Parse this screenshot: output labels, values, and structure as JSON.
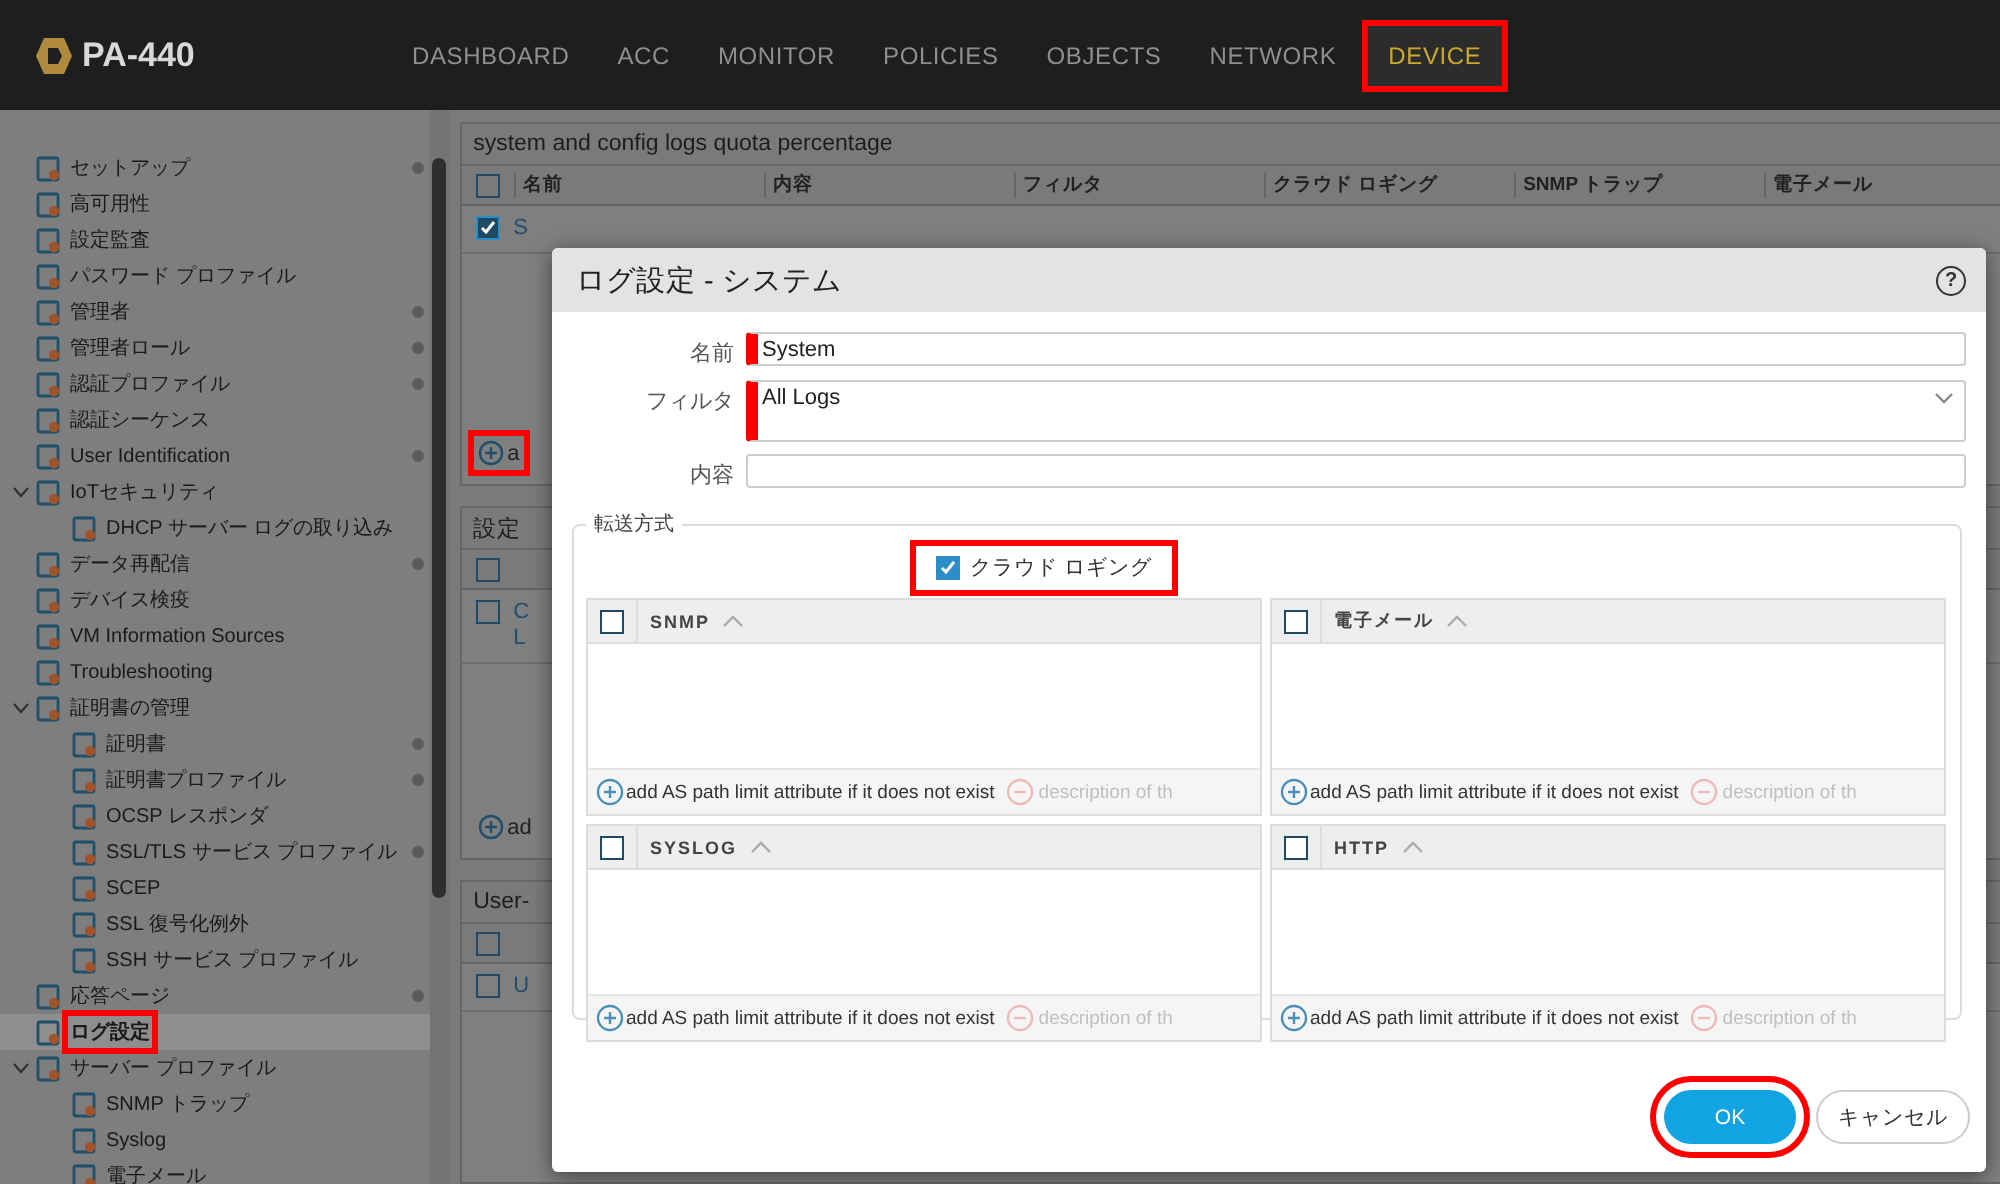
{
  "header": {
    "product": "PA-440",
    "tabs": [
      {
        "label": "DASHBOARD",
        "selected": false,
        "highlighted": false
      },
      {
        "label": "ACC",
        "selected": false,
        "highlighted": false
      },
      {
        "label": "MONITOR",
        "selected": false,
        "highlighted": false
      },
      {
        "label": "POLICIES",
        "selected": false,
        "highlighted": false
      },
      {
        "label": "OBJECTS",
        "selected": false,
        "highlighted": false
      },
      {
        "label": "NETWORK",
        "selected": false,
        "highlighted": false
      },
      {
        "label": "DEVICE",
        "selected": true,
        "highlighted": true
      }
    ]
  },
  "sidebar": {
    "items": [
      {
        "label": "セットアップ",
        "marked": true,
        "selected": false,
        "highlighted": false
      },
      {
        "label": "高可用性",
        "marked": false,
        "selected": false,
        "highlighted": false
      },
      {
        "label": "設定監査",
        "marked": false,
        "selected": false,
        "highlighted": false
      },
      {
        "label": "パスワード プロファイル",
        "marked": false,
        "selected": false,
        "highlighted": false
      },
      {
        "label": "管理者",
        "marked": true,
        "selected": false,
        "highlighted": false
      },
      {
        "label": "管理者ロール",
        "marked": true,
        "selected": false,
        "highlighted": false
      },
      {
        "label": "認証プロファイル",
        "marked": true,
        "selected": false,
        "highlighted": false
      },
      {
        "label": "認証シーケンス",
        "marked": false,
        "selected": false,
        "highlighted": false
      },
      {
        "label": "User Identification",
        "marked": true,
        "selected": false,
        "highlighted": false
      },
      {
        "label": "IoTセキュリティ",
        "marked": false,
        "selected": false,
        "highlighted": false,
        "expanded": true,
        "children": [
          {
            "label": "DHCP サーバー ログの取り込み",
            "marked": false,
            "selected": false,
            "highlighted": false
          }
        ]
      },
      {
        "label": "データ再配信",
        "marked": true,
        "selected": false,
        "highlighted": false
      },
      {
        "label": "デバイス検疫",
        "marked": false,
        "selected": false,
        "highlighted": false
      },
      {
        "label": "VM Information Sources",
        "marked": false,
        "selected": false,
        "highlighted": false
      },
      {
        "label": "Troubleshooting",
        "marked": false,
        "selected": false,
        "highlighted": false
      },
      {
        "label": "証明書の管理",
        "marked": false,
        "selected": false,
        "highlighted": false,
        "expanded": true,
        "children": [
          {
            "label": "証明書",
            "marked": true,
            "selected": false,
            "highlighted": false
          },
          {
            "label": "証明書プロファイル",
            "marked": true,
            "selected": false,
            "highlighted": false
          },
          {
            "label": "OCSP レスポンダ",
            "marked": false,
            "selected": false,
            "highlighted": false
          },
          {
            "label": "SSL/TLS サービス プロファイル",
            "marked": true,
            "selected": false,
            "highlighted": false
          },
          {
            "label": "SCEP",
            "marked": false,
            "selected": false,
            "highlighted": false
          },
          {
            "label": "SSL 復号化例外",
            "marked": false,
            "selected": false,
            "highlighted": false
          },
          {
            "label": "SSH サービス プロファイル",
            "marked": false,
            "selected": false,
            "highlighted": false
          }
        ]
      },
      {
        "label": "応答ページ",
        "marked": true,
        "selected": false,
        "highlighted": false
      },
      {
        "label": "ログ設定",
        "marked": false,
        "selected": true,
        "highlighted": true
      },
      {
        "label": "サーバー プロファイル",
        "marked": false,
        "selected": false,
        "highlighted": false,
        "expanded": true,
        "children": [
          {
            "label": "SNMP トラップ",
            "marked": false,
            "selected": false,
            "highlighted": false
          },
          {
            "label": "Syslog",
            "marked": false,
            "selected": false,
            "highlighted": false
          },
          {
            "label": "電子メール",
            "marked": false,
            "selected": false,
            "highlighted": false
          }
        ]
      }
    ]
  },
  "main": {
    "panels": [
      {
        "title": "system and config logs quota percentage",
        "columns": [
          "名前",
          "内容",
          "フィルタ",
          "クラウド ロギング",
          "SNMP トラップ",
          "電子メール"
        ],
        "all_checked": false,
        "rows": [
          {
            "selected": true,
            "lines": [
              "S"
            ]
          }
        ],
        "add": {
          "label": "a",
          "highlighted": true
        }
      },
      {
        "title": "設定",
        "all_checked": false,
        "rows": [
          {
            "selected": false,
            "lines": [
              "C",
              "L"
            ]
          }
        ],
        "add": {
          "label": "ad",
          "highlighted": false
        }
      },
      {
        "title": "User-",
        "all_checked": false,
        "rows": [
          {
            "selected": false,
            "lines": [
              "U"
            ]
          }
        ]
      }
    ]
  },
  "dialog": {
    "title": "ログ設定 - システム",
    "help": "?",
    "fields": [
      {
        "label": "名前",
        "value": "System",
        "kind": "text",
        "highlighted": true
      },
      {
        "label": "フィルタ",
        "value": "All Logs",
        "kind": "select",
        "highlighted": true
      },
      {
        "label": "内容",
        "kind": "text",
        "highlighted": false
      }
    ],
    "forwarding": {
      "legend": "転送方式",
      "cloud_logging": {
        "label": "クラウド ロギング",
        "checked": true,
        "highlighted": true
      },
      "panels": [
        {
          "title": "SNMP",
          "checked": false,
          "add": "add AS path limit attribute if it does not exist",
          "remove": "description of th"
        },
        {
          "title": "電子メール",
          "checked": false,
          "add": "add AS path limit attribute if it does not exist",
          "remove": "description of th"
        },
        {
          "title": "SYSLOG",
          "checked": false,
          "add": "add AS path limit attribute if it does not exist",
          "remove": "description of th"
        },
        {
          "title": "HTTP",
          "checked": false,
          "add": "add AS path limit attribute if it does not exist",
          "remove": "description of th"
        }
      ]
    },
    "buttons": [
      {
        "label": "OK",
        "kind": "primary",
        "highlighted": true
      },
      {
        "label": "キャンセル",
        "kind": "secondary",
        "highlighted": false
      }
    ]
  }
}
